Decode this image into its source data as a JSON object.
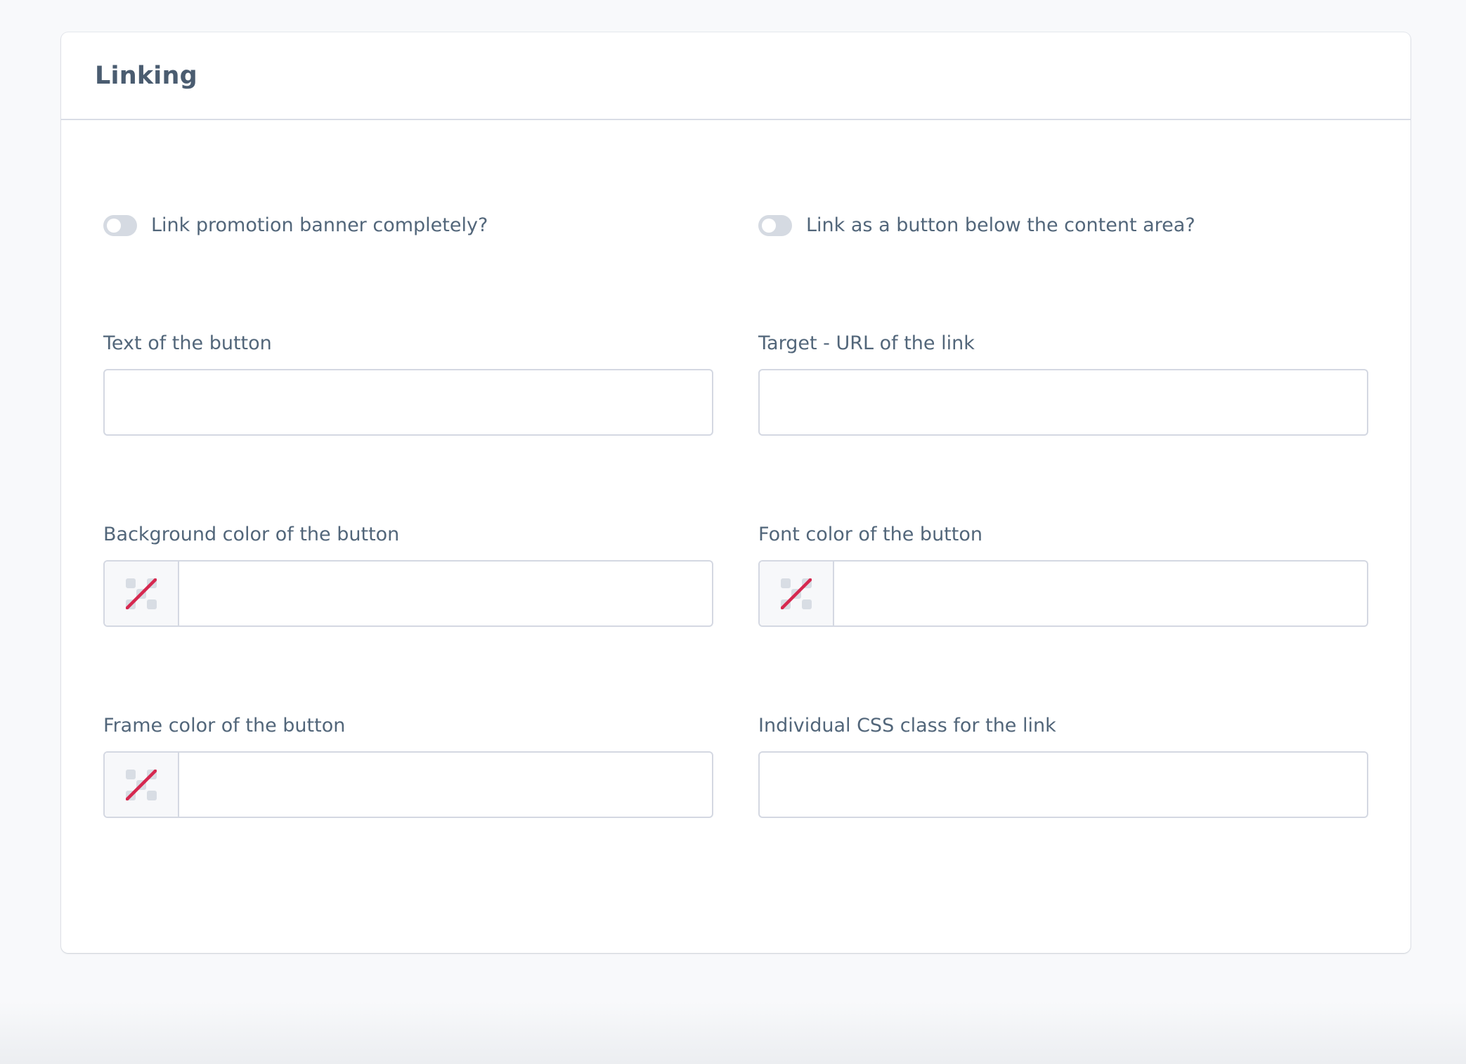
{
  "card": {
    "title": "Linking"
  },
  "toggles": [
    {
      "label": "Link promotion banner completely?",
      "checked": false
    },
    {
      "label": "Link as a button below the content area?",
      "checked": false
    }
  ],
  "fields": {
    "button_text": {
      "label": "Text of the button",
      "value": ""
    },
    "target_url": {
      "label": "Target - URL of the link",
      "value": ""
    },
    "background_color": {
      "label": "Background color of the button",
      "value": "",
      "icon": "no-color-icon"
    },
    "font_color": {
      "label": "Font color of the button",
      "value": "",
      "icon": "no-color-icon"
    },
    "frame_color": {
      "label": "Frame color of the button",
      "value": "",
      "icon": "no-color-icon"
    },
    "css_class": {
      "label": "Individual CSS class for the link",
      "value": ""
    }
  },
  "colors": {
    "accent_slash": "#d6284f",
    "toggle_off": "#d5dae2",
    "text": "#52667a"
  }
}
